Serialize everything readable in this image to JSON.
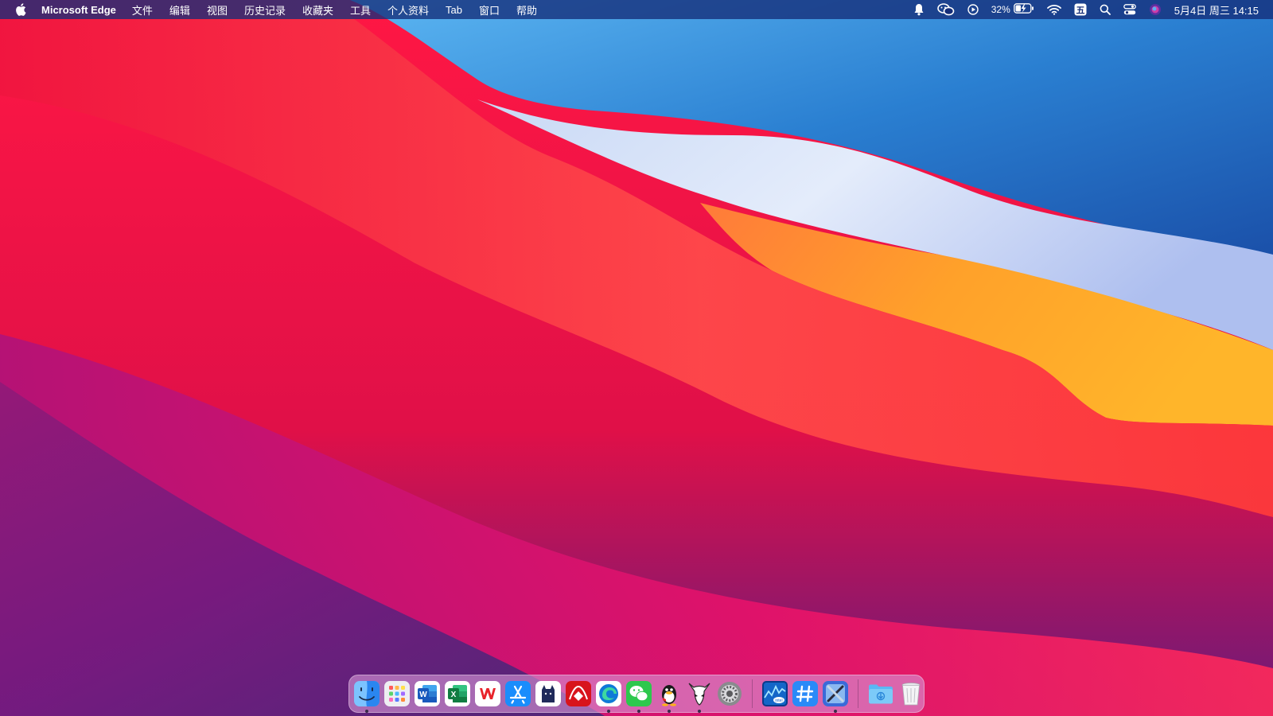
{
  "menubar": {
    "app_name": "Microsoft Edge",
    "menus": [
      "文件",
      "编辑",
      "视图",
      "历史记录",
      "收藏夹",
      "工具",
      "个人资料",
      "Tab",
      "窗口",
      "帮助"
    ],
    "battery_percent": "32%",
    "clock": "5月4日 周三  14:15",
    "status_icons": [
      "notification-bell-icon",
      "wechat-icon",
      "play-icon",
      "battery-charging-icon",
      "wifi-icon",
      "input-method-icon",
      "spotlight-search-icon",
      "control-center-icon",
      "siri-icon"
    ],
    "input_method_glyph": "五"
  },
  "dock": {
    "apps": [
      {
        "name": "Finder",
        "icon": "finder-icon",
        "running": true
      },
      {
        "name": "Launchpad",
        "icon": "launchpad-icon",
        "running": false
      },
      {
        "name": "Microsoft Word",
        "icon": "word-icon",
        "running": false
      },
      {
        "name": "Microsoft Excel",
        "icon": "excel-icon",
        "running": false
      },
      {
        "name": "WPS Office",
        "icon": "wps-icon",
        "running": false
      },
      {
        "name": "App Store",
        "icon": "app-store-icon",
        "running": false
      },
      {
        "name": "Cat App",
        "icon": "cat-app-icon",
        "running": false
      },
      {
        "name": "Red App",
        "icon": "red-app-icon",
        "running": false
      },
      {
        "name": "Microsoft Edge",
        "icon": "edge-icon",
        "running": true
      },
      {
        "name": "WeChat",
        "icon": "wechat-icon",
        "running": true
      },
      {
        "name": "QQ",
        "icon": "qq-icon",
        "running": true
      },
      {
        "name": "Alien App",
        "icon": "alien-app-icon",
        "running": true
      },
      {
        "name": "System Preferences",
        "icon": "system-preferences-icon",
        "running": false
      },
      {
        "name": "Intel Power Gadget",
        "icon": "intel-power-gadget-icon",
        "running": false
      },
      {
        "name": "Hashtag App",
        "icon": "hashtag-icon",
        "running": false
      },
      {
        "name": "Xcode-like Tool",
        "icon": "developer-tool-icon",
        "running": true
      }
    ],
    "folders": [
      {
        "name": "Downloads",
        "icon": "downloads-folder-icon"
      },
      {
        "name": "Trash",
        "icon": "trash-icon"
      }
    ]
  },
  "colors": {
    "menubar_bg": "#142d78",
    "wallpaper_red": "#e8163f",
    "wallpaper_blue": "#1f6fc4",
    "wallpaper_orange": "#ffa326",
    "wallpaper_purple": "#5a1f7a"
  }
}
